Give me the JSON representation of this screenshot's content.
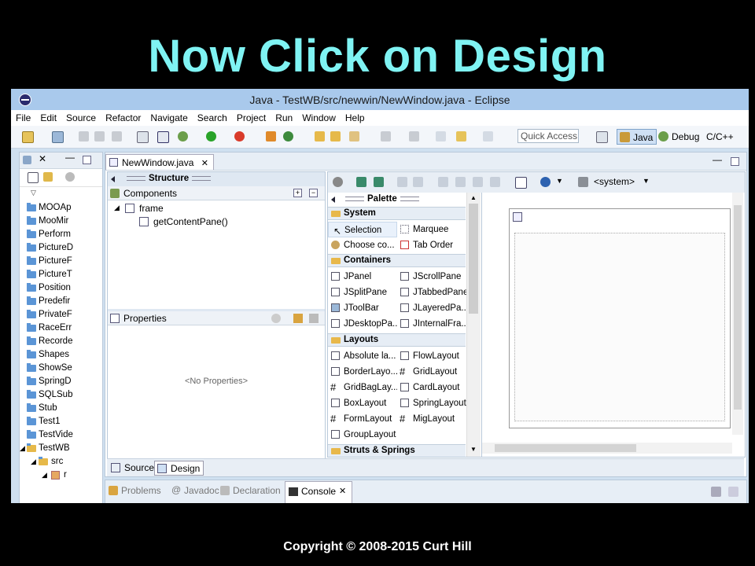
{
  "slide": {
    "title": "Now Click on Design",
    "copyright": "Copyright © 2008-2015 Curt Hill"
  },
  "window": {
    "title": "Java - TestWB/src/newwin/NewWindow.java - Eclipse"
  },
  "menu": [
    "File",
    "Edit",
    "Source",
    "Refactor",
    "Navigate",
    "Search",
    "Project",
    "Run",
    "Window",
    "Help"
  ],
  "toolbar": {
    "quick_access": "Quick Access",
    "perspectives": [
      {
        "label": "Java",
        "icon": "java-perspective-icon"
      },
      {
        "label": "Debug",
        "icon": "debug-perspective-icon"
      },
      {
        "label": "C/C++",
        "icon": ""
      }
    ]
  },
  "package_explorer": {
    "items": [
      "MOOAp",
      "MooMir",
      "Perform",
      "PictureD",
      "PictureF",
      "PictureT",
      "Position",
      "Predefir",
      "PrivateF",
      "RaceErr",
      "Recorde",
      "Shapes",
      "ShowSe",
      "SpringD",
      "SQLSub",
      "Stub",
      "Test1",
      "TestVide",
      "TestWB",
      "src",
      "r"
    ]
  },
  "editor": {
    "tab_label": "NewWindow.java",
    "structure": {
      "header": "Structure",
      "components_label": "Components",
      "tree": [
        {
          "label": "frame",
          "level": 0
        },
        {
          "label": "getContentPane()",
          "level": 1
        }
      ],
      "properties_label": "Properties",
      "no_properties": "<No Properties>"
    },
    "palette": {
      "header": "Palette",
      "system_combo": "<system>",
      "sections": [
        {
          "name": "System",
          "items": [
            "Selection",
            "Marquee",
            "Choose co...",
            "Tab Order"
          ]
        },
        {
          "name": "Containers",
          "items": [
            "JPanel",
            "JScrollPane",
            "JSplitPane",
            "JTabbedPane",
            "JToolBar",
            "JLayeredPa...",
            "JDesktopPa...",
            "JInternalFra..."
          ]
        },
        {
          "name": "Layouts",
          "items": [
            "Absolute la...",
            "FlowLayout",
            "BorderLayo...",
            "GridLayout",
            "GridBagLay...",
            "CardLayout",
            "BoxLayout",
            "SpringLayout",
            "FormLayout",
            "MigLayout",
            "GroupLayout"
          ]
        },
        {
          "name": "Struts & Springs",
          "items": []
        }
      ]
    },
    "bottom_tabs": [
      "Source",
      "Design"
    ]
  },
  "console_bar": {
    "tabs": [
      "Problems",
      "Javadoc",
      "Declaration",
      "Console"
    ]
  },
  "colors": {
    "title": "#7ff3f3",
    "background": "#000000",
    "window_titlebar": "#a9c9ec",
    "folder": "#5b95d6"
  }
}
